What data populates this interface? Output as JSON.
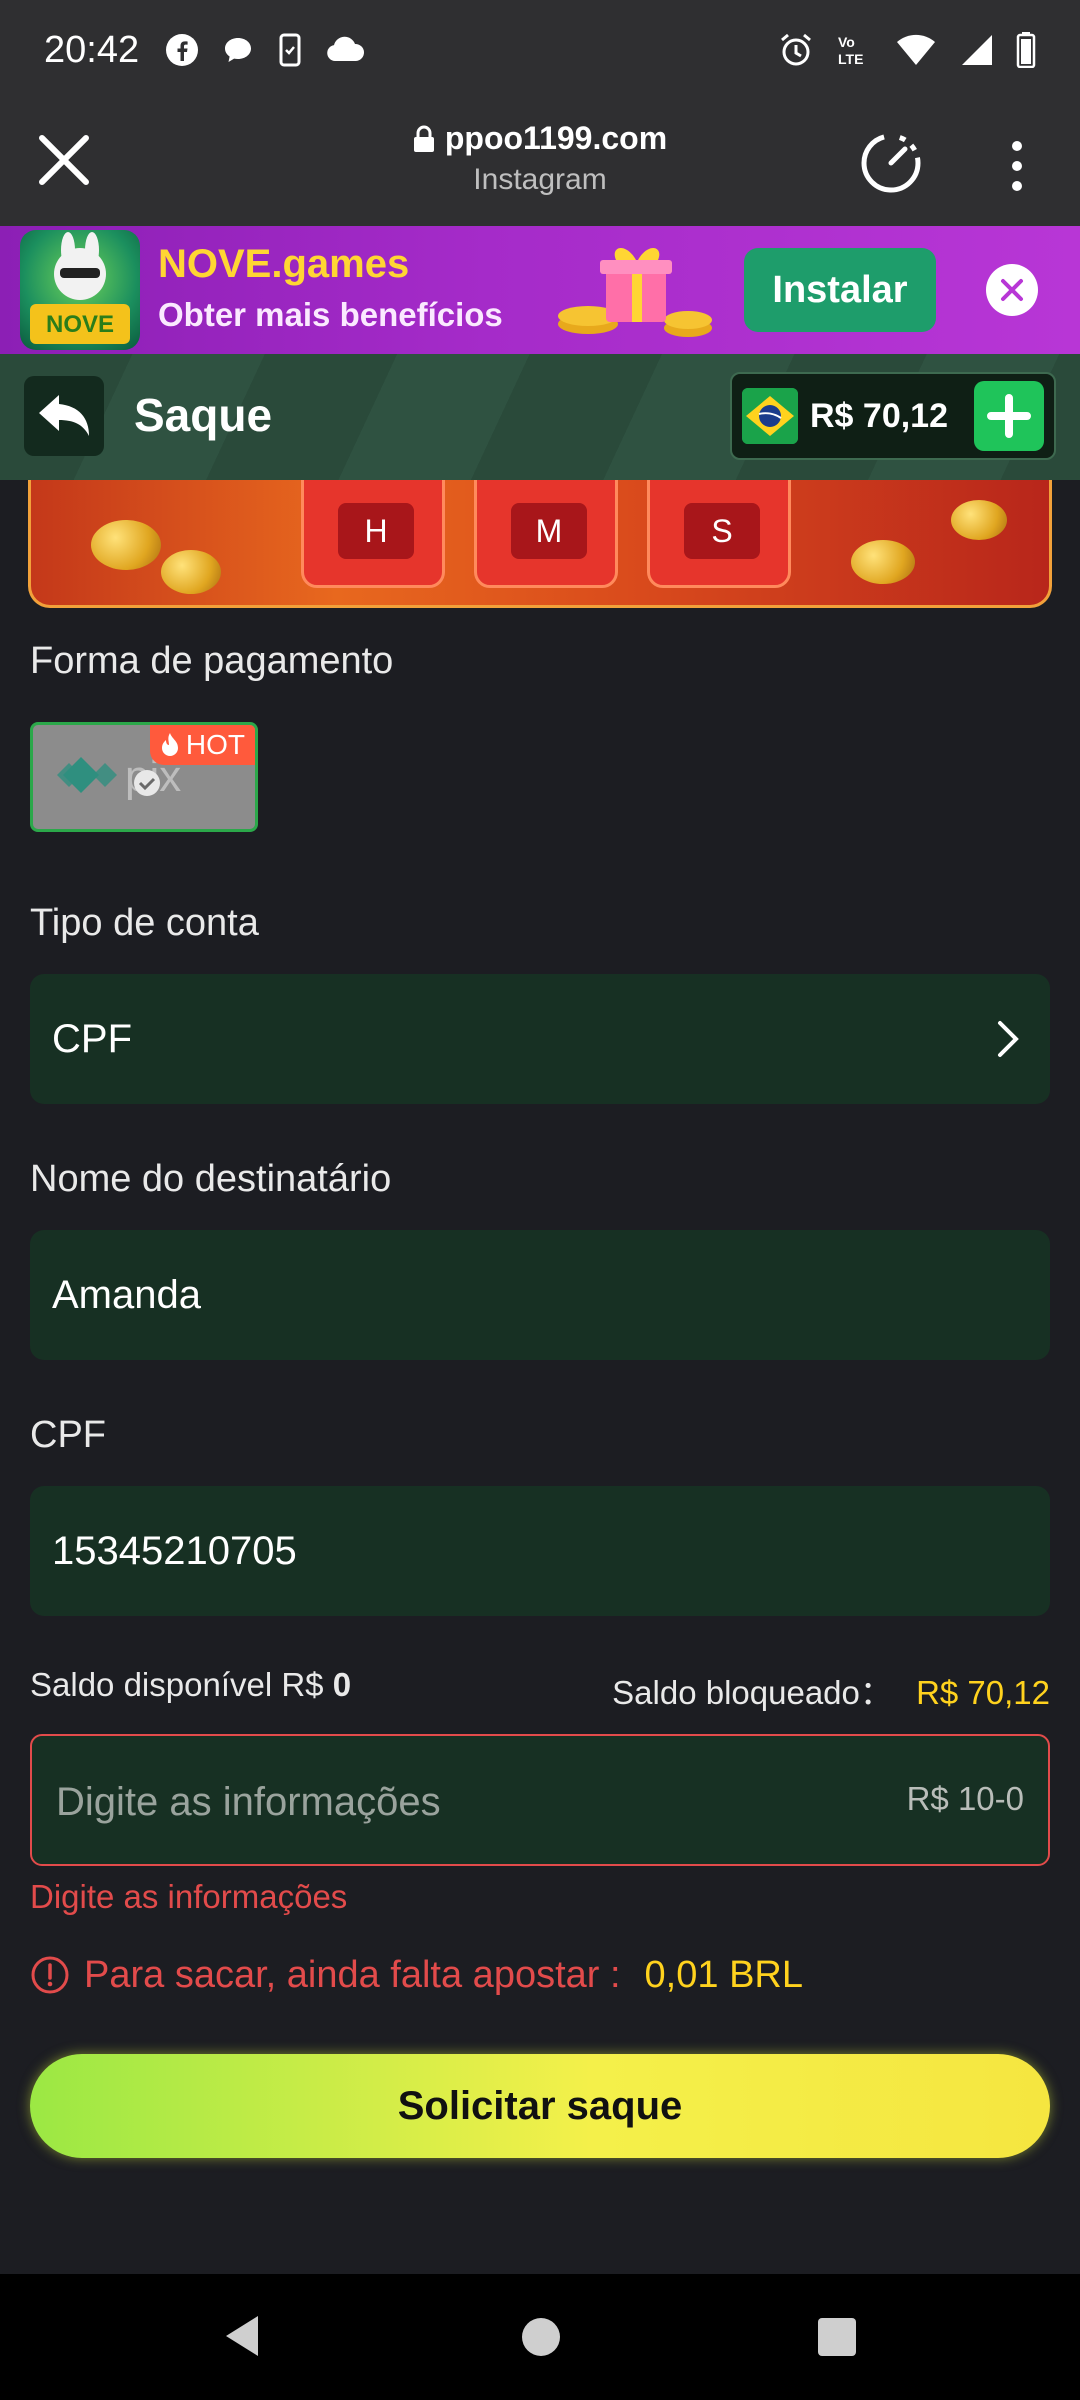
{
  "status_bar": {
    "time": "20:42"
  },
  "browser": {
    "url": "ppoo1199.com",
    "source": "Instagram"
  },
  "banner": {
    "title": "NOVE.games",
    "subtitle": "Obter mais benefícios",
    "install_label": "Instalar",
    "logo_text": "NOVE GAMES"
  },
  "header": {
    "title": "Saque",
    "balance": "R$ 70,12"
  },
  "promo": {
    "timer_units": [
      "H",
      "M",
      "S"
    ]
  },
  "payment": {
    "label": "Forma de pagamento",
    "method": "pix",
    "hot_label": "HOT"
  },
  "account_type": {
    "label": "Tipo de conta",
    "value": "CPF"
  },
  "recipient": {
    "label": "Nome do destinatário",
    "value": "Amanda"
  },
  "cpf": {
    "label": "CPF",
    "value": "15345210705"
  },
  "saldo": {
    "available_label": "Saldo disponível R$",
    "available_value": "0",
    "blocked_label": "Saldo bloqueado：",
    "blocked_value": "R$ 70,12"
  },
  "amount": {
    "placeholder": "Digite as informações",
    "range": "R$ 10-0"
  },
  "error": {
    "text": "Digite as informações"
  },
  "warning": {
    "text": "Para sacar, ainda falta apostar :",
    "value": "0,01 BRL"
  },
  "submit": {
    "label": "Solicitar saque"
  },
  "colors": {
    "accent_green": "#1fc45a",
    "error_red": "#e24b4b",
    "highlight_yellow": "#ffd21e",
    "field_bg": "#173023"
  }
}
